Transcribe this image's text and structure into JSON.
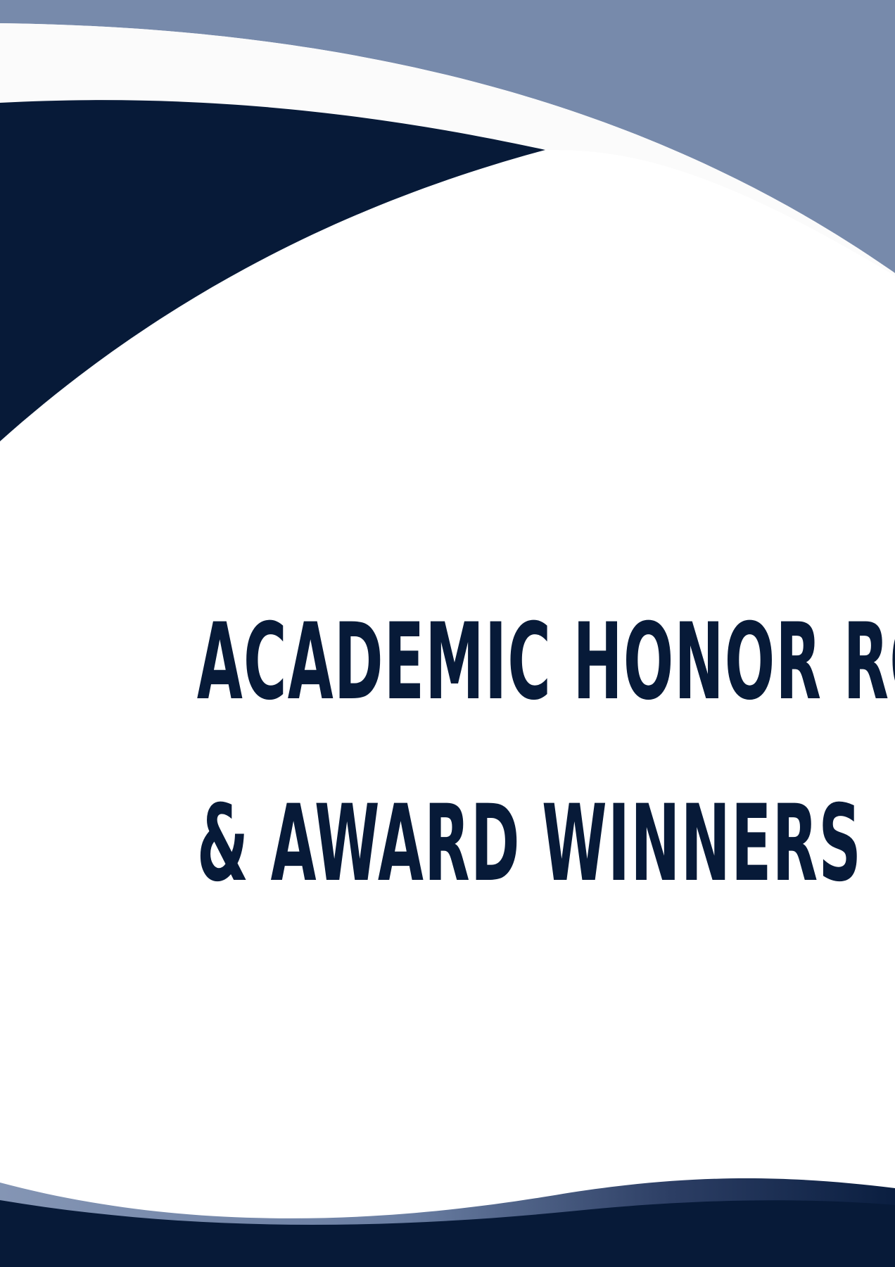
{
  "title": {
    "line1": "ACADEMIC HONOR ROLL",
    "line2": "& AWARD WINNERS"
  },
  "colors": {
    "navy": "#071a38",
    "slate_blue": "#778aab",
    "off_white": "#fbfbfb",
    "background": "#ffffff"
  }
}
